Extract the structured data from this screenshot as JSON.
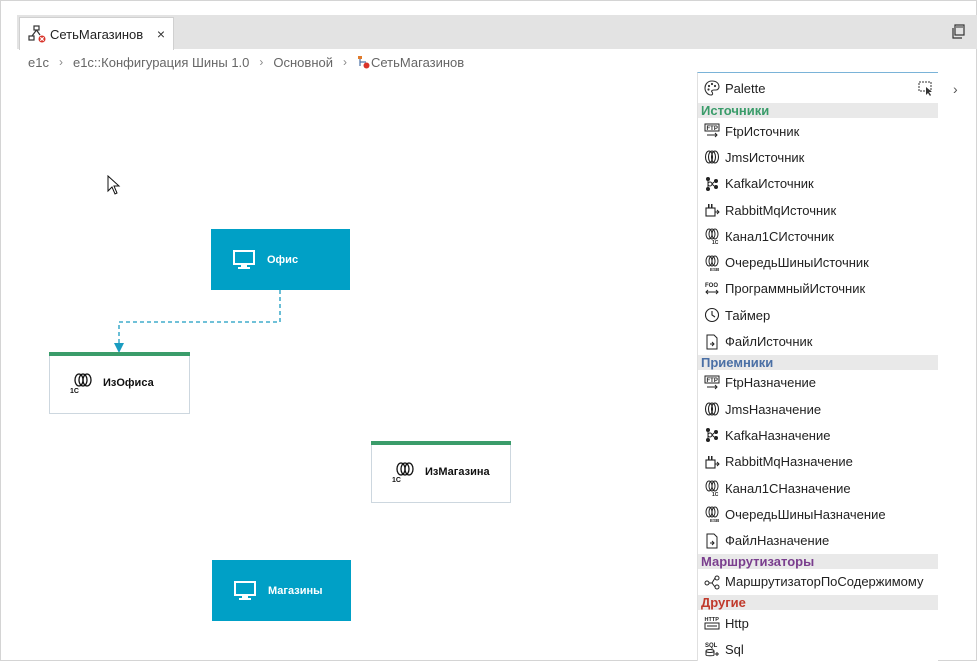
{
  "editor": {
    "tab_title": "СетьМагазинов",
    "tab_close": "×"
  },
  "breadcrumb": {
    "items": [
      "e1c",
      "e1c::Конфигурация Шины 1.0",
      "Основной",
      "СетьМагазинов"
    ],
    "separator": "›"
  },
  "diagram": {
    "nodes": {
      "office": "Офис",
      "from_office": "ИзОфиса",
      "from_store": "ИзМагазина",
      "stores": "Магазины"
    },
    "node_color": "#00a0c6",
    "channel_accent": "#3a9c6a",
    "connector_color": "#1a9cc0"
  },
  "palette": {
    "title": "Palette",
    "toggle": "›",
    "categories": [
      {
        "label": "Источники",
        "color": "#3a9c6a",
        "items": [
          {
            "label": "FtpИсточник",
            "icon": "ftp-icon"
          },
          {
            "label": "JmsИсточник",
            "icon": "jms-icon"
          },
          {
            "label": "KafkaИсточник",
            "icon": "kafka-icon"
          },
          {
            "label": "RabbitMqИсточник",
            "icon": "rabbitmq-icon"
          },
          {
            "label": "Канал1СИсточник",
            "icon": "channel-1c-icon"
          },
          {
            "label": "ОчередьШиныИсточник",
            "icon": "esb-queue-icon"
          },
          {
            "label": "ПрограммныйИсточник",
            "icon": "program-icon"
          },
          {
            "label": "Таймер",
            "icon": "clock-icon"
          },
          {
            "label": "ФайлИсточник",
            "icon": "file-icon"
          }
        ]
      },
      {
        "label": "Приемники",
        "color": "#4a6fa5",
        "items": [
          {
            "label": "FtpНазначение",
            "icon": "ftp-icon"
          },
          {
            "label": "JmsНазначение",
            "icon": "jms-icon"
          },
          {
            "label": "KafkaНазначение",
            "icon": "kafka-icon"
          },
          {
            "label": "RabbitMqНазначение",
            "icon": "rabbitmq-icon"
          },
          {
            "label": "Канал1СНазначение",
            "icon": "channel-1c-icon"
          },
          {
            "label": "ОчередьШиныНазначение",
            "icon": "esb-queue-icon"
          },
          {
            "label": "ФайлНазначение",
            "icon": "file-icon"
          }
        ]
      },
      {
        "label": "Маршрутизаторы",
        "color": "#7a3e8e",
        "items": [
          {
            "label": "МаршрутизаторПоСодержимому",
            "icon": "router-icon"
          }
        ]
      },
      {
        "label": "Другие",
        "color": "#c0392b",
        "items": [
          {
            "label": "Http",
            "icon": "http-icon"
          },
          {
            "label": "Sql",
            "icon": "sql-icon"
          }
        ]
      }
    ]
  }
}
